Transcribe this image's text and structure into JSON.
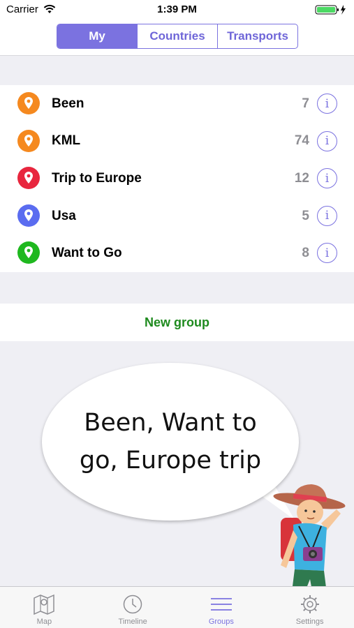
{
  "status_bar": {
    "carrier": "Carrier",
    "time": "1:39 PM",
    "wifi_icon": "wifi-icon",
    "battery_icon": "battery-icon"
  },
  "segments": [
    {
      "label": "My",
      "active": true
    },
    {
      "label": "Countries",
      "active": false
    },
    {
      "label": "Transports",
      "active": false
    }
  ],
  "groups": [
    {
      "name": "Been",
      "count": "7",
      "pin_color": "#f5891f"
    },
    {
      "name": "KML",
      "count": "74",
      "pin_color": "#f5891f"
    },
    {
      "name": "Trip to Europe",
      "count": "12",
      "pin_color": "#e8263e"
    },
    {
      "name": "Usa",
      "count": "5",
      "pin_color": "#5a6cf0"
    },
    {
      "name": "Want to Go",
      "count": "8",
      "pin_color": "#1fb81f"
    }
  ],
  "new_group_label": "New group",
  "promo": {
    "line1": "Been, Want to",
    "line2": "go, Europe trip"
  },
  "tab_bar": [
    {
      "label": "Map",
      "icon": "map-icon",
      "active": false
    },
    {
      "label": "Timeline",
      "icon": "clock-icon",
      "active": false
    },
    {
      "label": "Groups",
      "icon": "menu-lines-icon",
      "active": true
    },
    {
      "label": "Settings",
      "icon": "gear-icon",
      "active": false
    }
  ],
  "colors": {
    "accent": "#7b72e0",
    "new_group_text": "#1e8a1e",
    "battery": "#4cd964"
  }
}
